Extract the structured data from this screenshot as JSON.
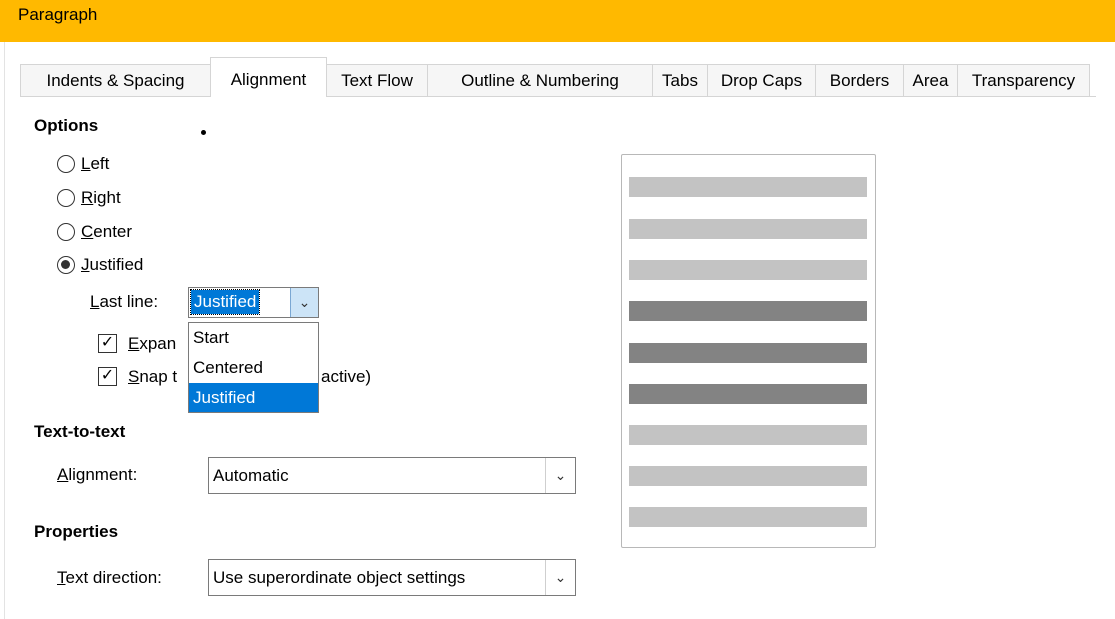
{
  "dialog": {
    "title": "Paragraph"
  },
  "tabs": [
    {
      "label": "Indents & Spacing"
    },
    {
      "label": "Alignment"
    },
    {
      "label": "Text Flow"
    },
    {
      "label": "Outline & Numbering"
    },
    {
      "label": "Tabs"
    },
    {
      "label": "Drop Caps"
    },
    {
      "label": "Borders"
    },
    {
      "label": "Area"
    },
    {
      "label": "Transparency"
    }
  ],
  "options": {
    "title": "Options",
    "radios": [
      {
        "label": "Left",
        "mnemonic": "L",
        "rest": "eft",
        "selected": false
      },
      {
        "label": "Right",
        "mnemonic": "R",
        "rest": "ight",
        "selected": false
      },
      {
        "label": "Center",
        "mnemonic": "C",
        "rest": "enter",
        "selected": false
      },
      {
        "label": "Justified",
        "mnemonic": "J",
        "rest": "ustified",
        "selected": true
      }
    ],
    "last_line": {
      "label_mnemonic": "L",
      "label_rest": "ast line:",
      "value": "Justified",
      "options": [
        "Start",
        "Centered",
        "Justified"
      ]
    },
    "expand_checkbox": {
      "visible_prefix_mnemonic": "E",
      "visible_prefix_rest": "xpan",
      "checked": true
    },
    "snap_checkbox": {
      "visible_prefix_mnemonic": "S",
      "visible_prefix_rest": "nap t",
      "visible_suffix": "active)",
      "checked": true
    }
  },
  "text_to_text": {
    "title": "Text-to-text",
    "alignment_label_mnemonic": "A",
    "alignment_label_rest": "lignment:",
    "alignment_value": "Automatic"
  },
  "properties": {
    "title": "Properties",
    "direction_label_mnemonic": "T",
    "direction_label_rest": "ext direction:",
    "direction_value": "Use superordinate object settings"
  },
  "preview": {
    "bars": [
      {
        "shade": "light"
      },
      {
        "shade": "light"
      },
      {
        "shade": "light"
      },
      {
        "shade": "dark"
      },
      {
        "shade": "dark"
      },
      {
        "shade": "dark"
      },
      {
        "shade": "light"
      },
      {
        "shade": "light"
      },
      {
        "shade": "light"
      }
    ],
    "colors": {
      "light": "#c3c3c3",
      "dark": "#838383"
    }
  },
  "colors": {
    "titlebar": "#ffb900",
    "selection": "#0078d7"
  }
}
